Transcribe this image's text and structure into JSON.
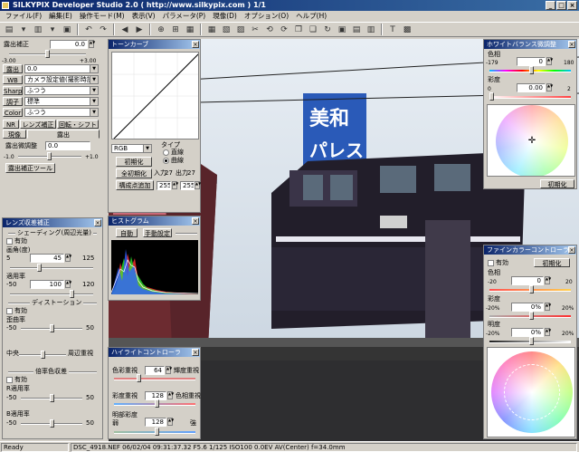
{
  "window": {
    "title": "SILKYPIX Developer Studio 2.0 ( http://www.silkypix.com )  1/1"
  },
  "menu": [
    "ファイル(F)",
    "編集(E)",
    "操作モード(M)",
    "表示(V)",
    "パラメータ(P)",
    "現像(D)",
    "オプション(O)",
    "ヘルプ(H)"
  ],
  "left_top": {
    "exposure_label": "露出補正",
    "exposure_value": "0.0",
    "exposure_min": "-3.00",
    "exposure_max": "+3.00",
    "rows": [
      {
        "label": "露出",
        "value": "0.0"
      },
      {
        "label": "WB",
        "value": "カメラ設定値(撮影時設定)"
      },
      {
        "label": "Sharp",
        "value": "ふつう"
      },
      {
        "label": "調子",
        "value": "標準"
      },
      {
        "label": "Color",
        "value": "ふつう"
      }
    ],
    "tabs": [
      "NR",
      "レンズ補正",
      "回転・シフト",
      "現像",
      "露出"
    ],
    "exposure_adjust_label": "露出微調整",
    "exposure_adjust_value": "0.0",
    "adjust_min": "-1.0",
    "adjust_max": "+1.0",
    "tool_button": "露出補正ツール"
  },
  "lens_panel": {
    "title": "レンズ収差補正",
    "shading_section": "シェーディング(周辺光量)",
    "enable1": "有効",
    "angle_label": "画角(度)",
    "angle_min": "5",
    "angle_value": "45",
    "angle_max": "125",
    "apply_label": "適用率",
    "apply_min": "-50",
    "apply_value": "100",
    "apply_max": "120",
    "distortion_section": "ディストーション",
    "enable2": "有効",
    "distortion_label": "歪曲率",
    "dist_min": "-50",
    "dist_max": "50",
    "center_label": "中央",
    "periph_label": "周辺重視",
    "chromatic_section": "倍率色収差",
    "enable3": "有効",
    "r_label": "R適用率",
    "r_min": "-50",
    "r_max": "50",
    "b_label": "B適用率",
    "b_min": "-50",
    "b_max": "50"
  },
  "tone_panel": {
    "title": "トーンカーブ",
    "channel": "RGB",
    "type_label": "タイプ",
    "type_opt1": "直線",
    "type_opt2": "曲線",
    "btn_init": "初期化",
    "btn_all_init": "全初期化",
    "btn_add": "構成点追加",
    "input_label": "入力",
    "input_value": "27",
    "output_label": "出力",
    "output_value": "27",
    "val_a": "255",
    "val_b": "255"
  },
  "histogram": {
    "title": "ヒストグラム",
    "btn_auto": "自動",
    "btn_manual": "手動設定"
  },
  "highlight_panel": {
    "title": "ハイライトコントローラ",
    "label1": "色彩重視",
    "value1": "64",
    "right1": "輝度重視",
    "label2": "彩度重視",
    "value2": "128",
    "right2": "色相重視",
    "label3": "明部彩度",
    "label3b": "弱",
    "value3": "128",
    "right3": "強"
  },
  "wb_panel": {
    "title": "ホワイトバランス微調整",
    "hue_label": "色相",
    "hue_min": "-179",
    "hue_value": "0",
    "hue_max": "180",
    "sat_label": "彩度",
    "sat_min": "0",
    "sat_value": "0.00",
    "sat_max": "2",
    "btn_init": "初期化"
  },
  "fine_color": {
    "title": "ファインカラーコントローラ",
    "enable": "有効",
    "btn_init": "初期化",
    "hue_label": "色相",
    "hue_min": "-20",
    "hue_value": "0",
    "hue_max": "20",
    "sat_label": "彩度",
    "sat_min": "-20%",
    "sat_value": "0%",
    "sat_max": "20%",
    "light_label": "明度",
    "light_min": "-20%",
    "light_value": "0%",
    "light_max": "20%"
  },
  "photo": {
    "sign_line1": "美和",
    "sign_line2": "パレス"
  },
  "status": {
    "ready": "Ready",
    "info": "DSC_4918.NEF 06/02/04 09:31:37.32 F5.6 1/125 ISO100 0.0EV AV(Center) f=34.0mm"
  },
  "colors": {
    "accent": "#0a246a",
    "panel_bg": "#d4d0c8",
    "title_grad_end": "#a6caf0"
  }
}
